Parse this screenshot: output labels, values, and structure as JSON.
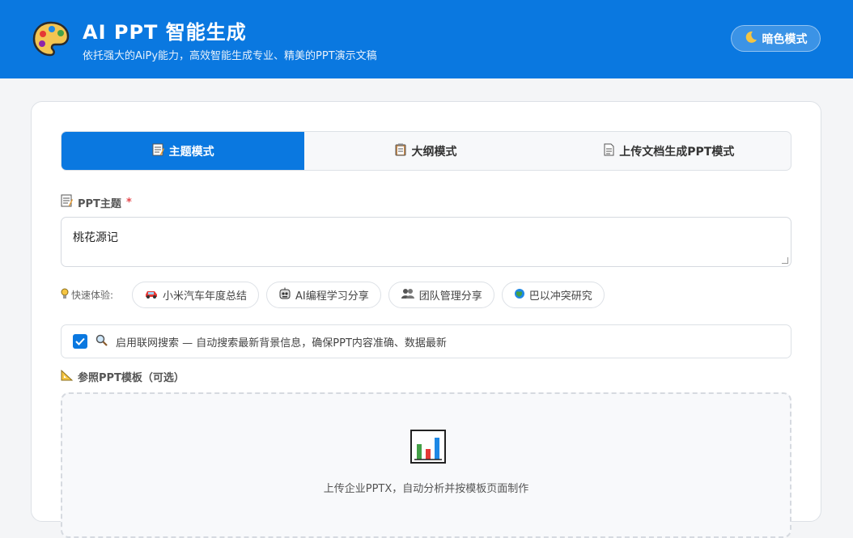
{
  "header": {
    "title": "AI PPT 智能生成",
    "subtitle": "依托强大的AiPy能力，高效智能生成专业、精美的PPT演示文稿",
    "dark_mode_icon": "moon-icon",
    "dark_mode_label": "暗色模式",
    "logo_icon": "palette-icon"
  },
  "tabs": [
    {
      "icon": "memo-icon",
      "label": "主题模式",
      "active": true
    },
    {
      "icon": "clipboard-icon",
      "label": "大纲模式",
      "active": false
    },
    {
      "icon": "document-icon",
      "label": "上传文档生成PPT模式",
      "active": false
    }
  ],
  "topic": {
    "label": "PPT主题",
    "required_mark": "*",
    "value": "桃花源记"
  },
  "quick": {
    "label": "快速体验:",
    "chips": [
      {
        "icon": "car-icon",
        "label": "小米汽车年度总结"
      },
      {
        "icon": "robot-icon",
        "label": "AI编程学习分享"
      },
      {
        "icon": "people-icon",
        "label": "团队管理分享"
      },
      {
        "icon": "globe-icon",
        "label": "巴以冲突研究"
      }
    ]
  },
  "search": {
    "checked": true,
    "label": "启用联网搜索 — 自动搜索最新背景信息，确保PPT内容准确、数据最新"
  },
  "template": {
    "label": "参照PPT模板（可选）",
    "upload_text": "上传企业PPTX，自动分析并按模板页面制作"
  },
  "colors": {
    "primary": "#0a78e0",
    "required": "#e5484d"
  }
}
